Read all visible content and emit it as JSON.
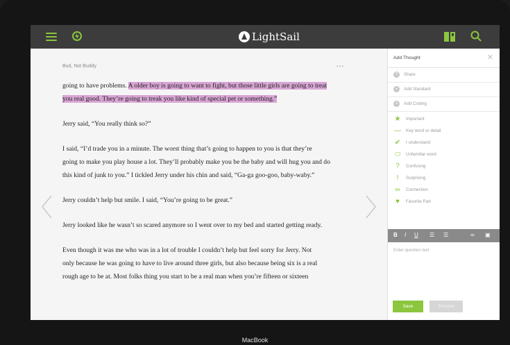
{
  "device": {
    "brand_label": "MacBook"
  },
  "topbar": {
    "app_name": "LightSail",
    "icons": [
      "menu-icon",
      "lightning-icon",
      "book-icon",
      "search-icon"
    ],
    "accent_color": "#8cc63e"
  },
  "reader": {
    "book_title": "Bud, Not Buddy",
    "more_label": "•••",
    "paragraphs": [
      {
        "lines": [
          {
            "plain": "going to have problems. ",
            "highlight": "A older boy is going to want to fight, but those little girls are going to treat"
          },
          {
            "plain": "",
            "highlight": "you real good. They’re going to treak you like kind of special pet or something.”"
          }
        ]
      },
      {
        "lines": [
          {
            "plain": "Jerry said, “You really think so?”",
            "highlight": ""
          }
        ]
      },
      {
        "lines": [
          {
            "plain": "I said, “I’d trade you in a minute. The worst thing that’s going to happen to you is that they’re",
            "highlight": ""
          },
          {
            "plain": "going to make you play house a lot. They’ll probably make you be the baby and will hug you and do",
            "highlight": ""
          },
          {
            "plain": "this kind of junk to you.” I tickled Jerry under his chin and said, “Ga-ga goo-goo, baby-waby.”",
            "highlight": ""
          }
        ]
      },
      {
        "lines": [
          {
            "plain": "Jerry couldn’t help but smile. I said, “You’re going to be great.”",
            "highlight": ""
          }
        ]
      },
      {
        "lines": [
          {
            "plain": "Jerry looked like he wasn’t so scared anymore so I went over to my bed and started getting ready.",
            "highlight": ""
          }
        ]
      },
      {
        "lines": [
          {
            "plain": "Even though it was me who was in a lot of trouble I couldn’t help but feel sorry for Jerry. Not",
            "highlight": ""
          },
          {
            "plain": "only because he was going to have to live around three girls, but also because being six is a real",
            "highlight": ""
          },
          {
            "plain": "rough age to be at. Most folks thing you start to be a real man when you’re fifteen or sixteen",
            "highlight": ""
          }
        ]
      }
    ],
    "highlight_color": "#d8a5d4"
  },
  "panel": {
    "title": "Add Thought",
    "close_label": "✕",
    "actions": [
      "Share",
      "Add Standard",
      "Add Coding"
    ],
    "tags": [
      {
        "icon": "star-icon",
        "symbol": "★",
        "label": "Important"
      },
      {
        "icon": "underline-icon",
        "symbol": "—",
        "label": "Key word or detail"
      },
      {
        "icon": "check-icon",
        "symbol": "✔",
        "label": "I understand"
      },
      {
        "icon": "ellipse-icon",
        "symbol": "⬭",
        "label": "Unfamiliar word"
      },
      {
        "icon": "question-icon",
        "symbol": "?",
        "label": "Confusing"
      },
      {
        "icon": "exclamation-icon",
        "symbol": "!",
        "label": "Surprising"
      },
      {
        "icon": "connection-icon",
        "symbol": "∞",
        "label": "Connection"
      },
      {
        "icon": "favorite-icon",
        "symbol": "♥",
        "label": "Favorite Part"
      }
    ],
    "editor": {
      "tools": [
        "B",
        "I",
        "U",
        "☰",
        "☰",
        "∞",
        "▣"
      ],
      "placeholder": "Enter question text"
    },
    "save_label": "Save",
    "preview_label": "Preview"
  }
}
